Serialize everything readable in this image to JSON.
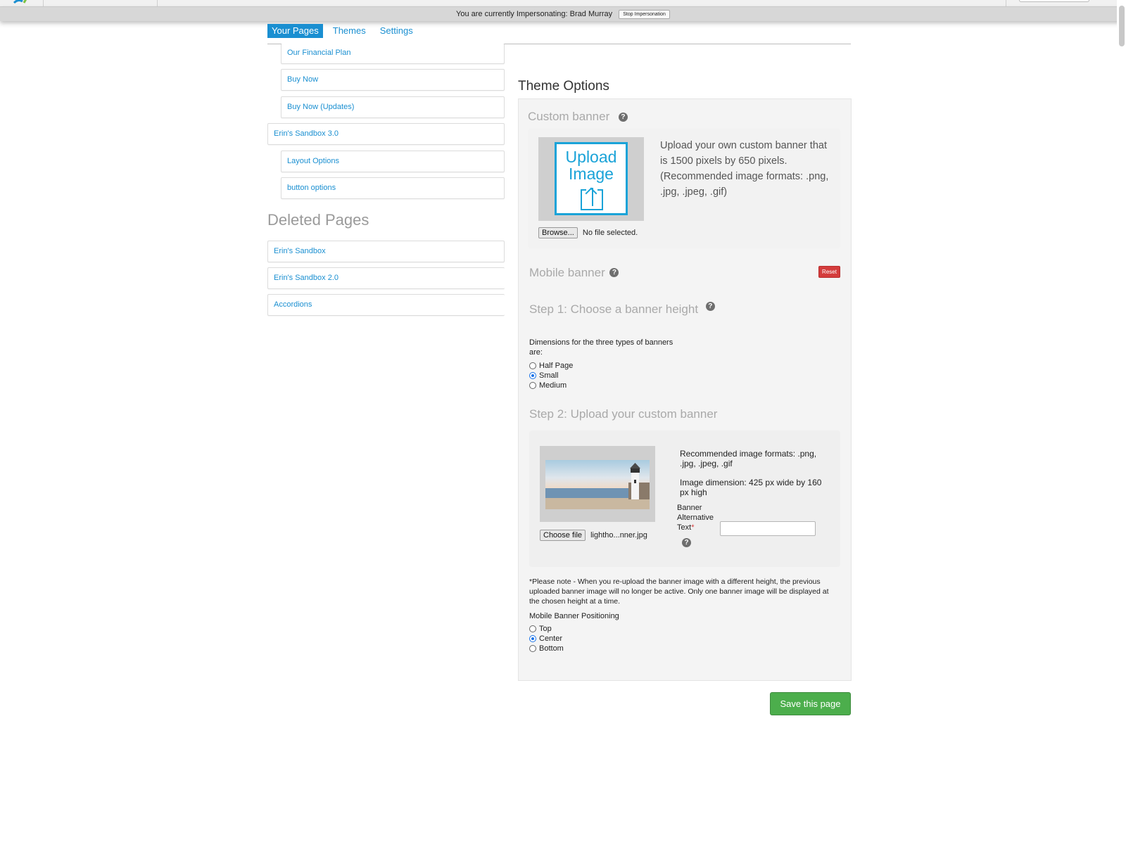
{
  "impersonation": {
    "text": "You are currently Impersonating: Brad Murray",
    "stop_label": "Stop Impersonation"
  },
  "tabs": [
    {
      "label": "Your Pages",
      "active": true
    },
    {
      "label": "Themes",
      "active": false
    },
    {
      "label": "Settings",
      "active": false
    }
  ],
  "pages": {
    "items": [
      {
        "label": "Our Financial Plan",
        "indent": 1
      },
      {
        "label": "Buy Now",
        "indent": 1
      },
      {
        "label": "Buy Now (Updates)",
        "indent": 1
      },
      {
        "label": "Erin's Sandbox 3.0",
        "indent": 0
      },
      {
        "label": "Layout Options",
        "indent": 1
      },
      {
        "label": "button options",
        "indent": 1
      }
    ],
    "deleted_title": "Deleted Pages",
    "deleted_items": [
      {
        "label": "Erin's Sandbox"
      },
      {
        "label": "Erin's Sandbox 2.0"
      },
      {
        "label": "Accordions"
      }
    ]
  },
  "theme": {
    "title": "Theme Options",
    "custom_banner": {
      "heading": "Custom banner",
      "upload_text_1": "Upload",
      "upload_text_2": "Image",
      "description": "Upload your own custom banner that is 1500 pixels by 650 pixels. (Recommended image formats: .png, .jpg, .jpeg, .gif)",
      "browse_label": "Browse...",
      "file_status": "No file selected."
    },
    "mobile_banner": {
      "heading": "Mobile banner",
      "reset_label": "Reset",
      "step1": "Step 1: Choose a banner height",
      "dimensions_label": "Dimensions for the three types of banners are:",
      "height_options": [
        {
          "label": "Half Page",
          "checked": false
        },
        {
          "label": "Small",
          "checked": true
        },
        {
          "label": "Medium",
          "checked": false
        }
      ],
      "step2": "Step 2: Upload your custom banner",
      "formats": "Recommended image formats: .png, .jpg, .jpeg, .gif",
      "dimension": "Image dimension: 425 px wide by 160 px high",
      "alt_label": "Banner Alternative Text",
      "alt_required": "*",
      "alt_value": "",
      "choose_label": "Choose file",
      "file_name": "lightho...nner.jpg",
      "note": "*Please note - When you re-upload the banner image with a different height, the previous uploaded banner image will no longer be active. Only one banner image will be displayed at the chosen height at a time.",
      "positioning_label": "Mobile Banner Positioning",
      "position_options": [
        {
          "label": "Top",
          "checked": false
        },
        {
          "label": "Center",
          "checked": true
        },
        {
          "label": "Bottom",
          "checked": false
        }
      ]
    },
    "save_label": "Save this page"
  },
  "help_glyph": "?",
  "colors": {
    "accent": "#1a8fd1",
    "save": "#4cae4c",
    "reset": "#d43c3c"
  }
}
